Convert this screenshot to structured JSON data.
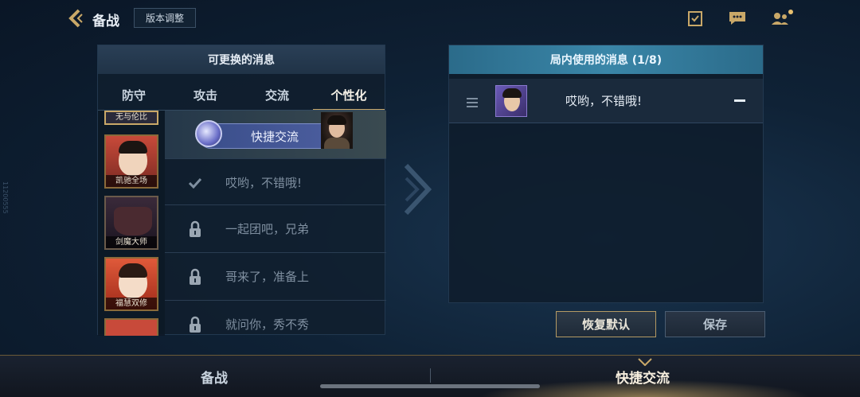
{
  "header": {
    "title": "备战",
    "version_button": "版本调整"
  },
  "side_label": "11200555",
  "left_panel": {
    "title": "可更换的消息",
    "tabs": [
      {
        "label": "防守",
        "active": false
      },
      {
        "label": "攻击",
        "active": false
      },
      {
        "label": "交流",
        "active": false
      },
      {
        "label": "个性化",
        "active": true
      }
    ],
    "characters": [
      {
        "name": "无与伦比"
      },
      {
        "name": "凯驰全场"
      },
      {
        "name": "剑魔大师"
      },
      {
        "name": "福慧双修"
      }
    ],
    "quick_chat_label": "快捷交流",
    "messages": [
      {
        "text": "哎哟，不错哦!",
        "state": "selected"
      },
      {
        "text": "一起团吧，兄弟",
        "state": "locked"
      },
      {
        "text": "哥来了，准备上",
        "state": "locked"
      },
      {
        "text": "就问你，秀不秀",
        "state": "locked"
      }
    ]
  },
  "right_panel": {
    "title": "局内使用的消息 (1/8)",
    "items": [
      {
        "text": "哎哟，不错哦!"
      }
    ]
  },
  "buttons": {
    "restore": "恢复默认",
    "save": "保存"
  },
  "bottom_tabs": [
    {
      "label": "备战",
      "active": false
    },
    {
      "label": "快捷交流",
      "active": true
    }
  ],
  "colors": {
    "gold": "#c9a868",
    "accent_teal": "#3a86a8"
  }
}
